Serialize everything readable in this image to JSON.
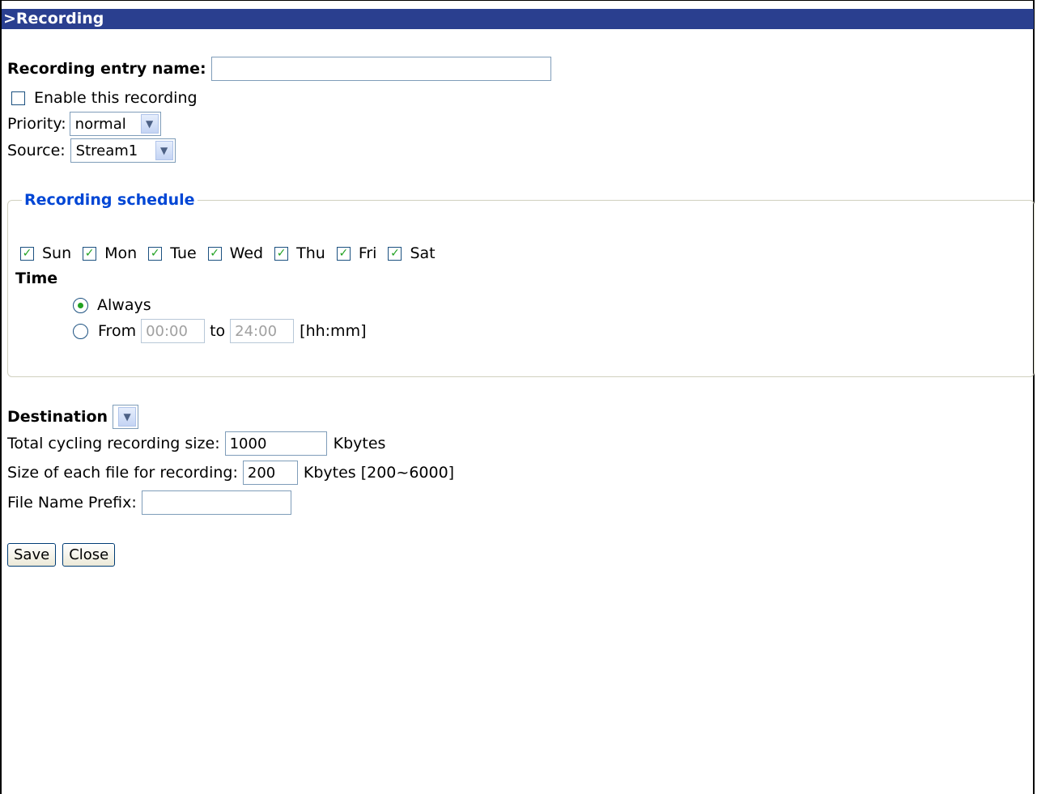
{
  "title": ">Recording",
  "entry_name": {
    "label": "Recording entry name:",
    "value": ""
  },
  "enable": {
    "label": "Enable this recording",
    "checked": false
  },
  "priority": {
    "label": "Priority:",
    "value": "normal"
  },
  "source": {
    "label": "Source:",
    "value": "Stream1"
  },
  "schedule": {
    "legend": "Recording schedule",
    "days": [
      {
        "label": "Sun",
        "checked": true
      },
      {
        "label": "Mon",
        "checked": true
      },
      {
        "label": "Tue",
        "checked": true
      },
      {
        "label": "Wed",
        "checked": true
      },
      {
        "label": "Thu",
        "checked": true
      },
      {
        "label": "Fri",
        "checked": true
      },
      {
        "label": "Sat",
        "checked": true
      }
    ],
    "time_label": "Time",
    "always_label": "Always",
    "from_label": "From",
    "from_value": "00:00",
    "to_label": "to",
    "to_value": "24:00",
    "format_hint": "[hh:mm]"
  },
  "destination": {
    "label": "Destination",
    "value": ""
  },
  "cycling": {
    "label": "Total cycling recording size:",
    "value": "1000",
    "unit": "Kbytes"
  },
  "file_size": {
    "label": "Size of each file for recording:",
    "value": "200",
    "unit": "Kbytes [200~6000]"
  },
  "prefix": {
    "label": "File Name Prefix:",
    "value": ""
  },
  "buttons": {
    "save": "Save",
    "close": "Close"
  }
}
